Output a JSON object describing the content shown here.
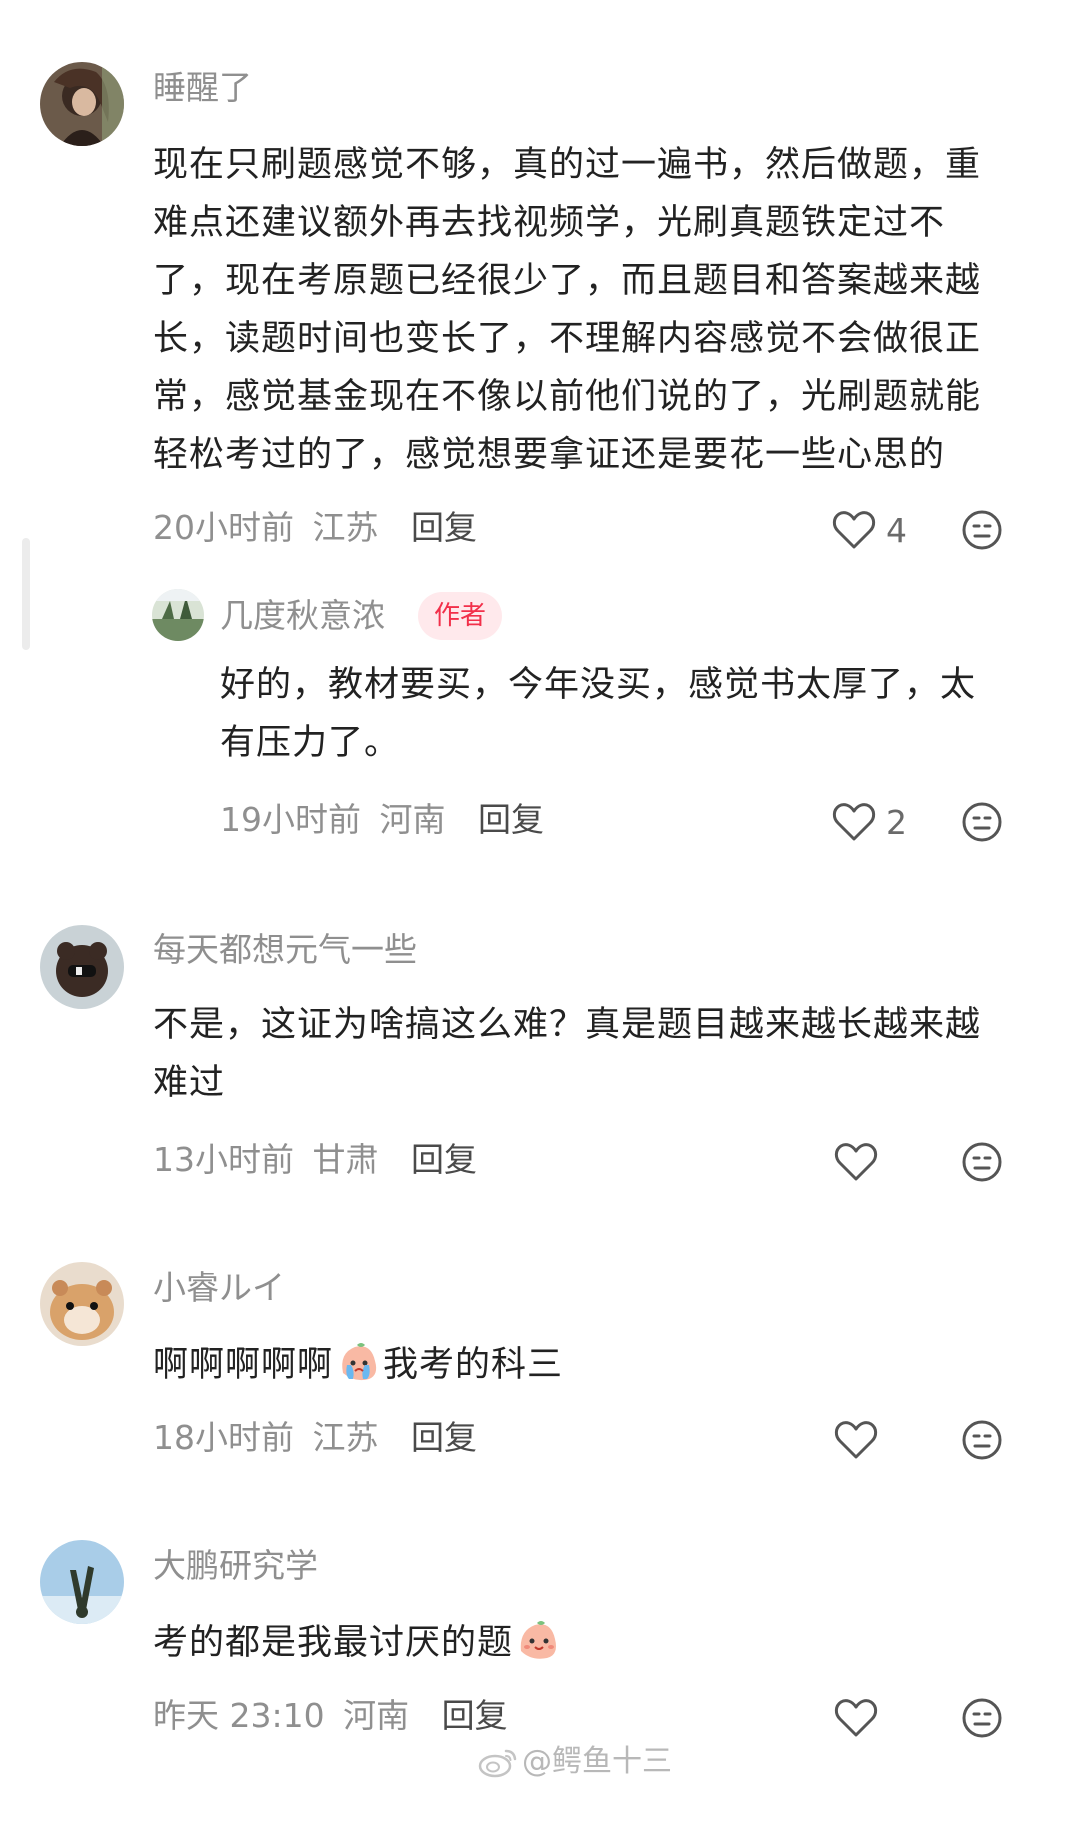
{
  "comments": [
    {
      "username": "睡醒了",
      "lines": [
        "现在只刷题感觉不够，真的过一遍书，然后做题，重",
        "难点还建议额外再去找视频学，光刷真题铁定过不",
        "了，现在考原题已经很少了，而且题目和答案越来越",
        "长，读题时间也变长了，不理解内容感觉不会做很正",
        "常，感觉基金现在不像以前他们说的了，光刷题就能",
        "轻松考过的了，感觉想要拿证还是要花一些心思的"
      ],
      "time": "20小时前",
      "location": "江苏",
      "reply": "回复",
      "likes": "4",
      "reply_comment": {
        "username": "几度秋意浓",
        "badge": "作者",
        "lines": [
          "好的，教材要买，今年没买，感觉书太厚了，太",
          "有压力了。"
        ],
        "time": "19小时前",
        "location": "河南",
        "reply": "回复",
        "likes": "2"
      }
    },
    {
      "username": "每天都想元气一些",
      "lines": [
        "不是，这证为啥搞这么难？真是题目越来越长越来越",
        "难过"
      ],
      "time": "13小时前",
      "location": "甘肃",
      "reply": "回复"
    },
    {
      "username": "小睿ルイ",
      "text_before_emoji": "啊啊啊啊啊",
      "text_after_emoji": "我考的科三",
      "emoji": "crying-face-emoji",
      "time": "18小时前",
      "location": "江苏",
      "reply": "回复"
    },
    {
      "username": "大鹏研究学",
      "text_before_emoji": "考的都是我最讨厌的题",
      "emoji": "smiling-blob-emoji",
      "time": "昨天 23:10",
      "location": "河南",
      "reply": "回复"
    }
  ],
  "watermark": "@鳄鱼十三",
  "colors": {
    "username": "#8f8f8f",
    "text": "#222222",
    "badge_bg": "#ffe9ec",
    "badge_text": "#f2304a"
  }
}
